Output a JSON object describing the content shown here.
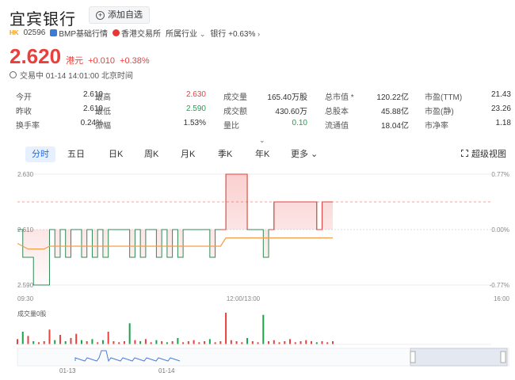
{
  "header": {
    "title": "宜宾银行",
    "fav_label": "添加自选",
    "market_tag": "HK",
    "code": "02596",
    "bmp_label": "BMP基础行情",
    "exchange": "香港交易所",
    "industry_label": "所属行业",
    "industry_value": "银行 +0.63%"
  },
  "quote": {
    "price": "2.620",
    "currency": "港元",
    "change": "+0.010",
    "change_pct": "+0.38%",
    "status": "交易中 01-14 14:01:00 北京时间"
  },
  "stats": [
    [
      {
        "label": "今开",
        "value": "2.610",
        "cls": ""
      },
      {
        "label": "最高",
        "value": "2.630",
        "cls": "up"
      },
      {
        "label": "成交量",
        "value": "165.40万股",
        "cls": ""
      },
      {
        "label": "总市值 *",
        "value": "120.22亿",
        "cls": ""
      },
      {
        "label": "市盈(TTM)",
        "value": "21.43",
        "cls": ""
      }
    ],
    [
      {
        "label": "昨收",
        "value": "2.610",
        "cls": ""
      },
      {
        "label": "最低",
        "value": "2.590",
        "cls": "down"
      },
      {
        "label": "成交额",
        "value": "430.60万",
        "cls": ""
      },
      {
        "label": "总股本",
        "value": "45.88亿",
        "cls": ""
      },
      {
        "label": "市盈(静)",
        "value": "23.26",
        "cls": ""
      }
    ],
    [
      {
        "label": "换手率",
        "value": "0.24%",
        "cls": ""
      },
      {
        "label": "振幅",
        "value": "1.53%",
        "cls": ""
      },
      {
        "label": "量比",
        "value": "0.10",
        "cls": "down"
      },
      {
        "label": "流通值",
        "value": "18.04亿",
        "cls": ""
      },
      {
        "label": "市净率",
        "value": "1.18",
        "cls": ""
      }
    ]
  ],
  "tabs": [
    "分时",
    "五日",
    "日K",
    "周K",
    "月K",
    "季K",
    "年K",
    "更多"
  ],
  "super_view": "超级视图",
  "chart": {
    "ylabels_left": [
      "2.630",
      "2.610",
      "2.590"
    ],
    "ylabels_right": [
      "0.77%",
      "0.00%",
      "-0.77%"
    ],
    "xlabels": [
      "09:30",
      "12:00/13:00",
      "16:00"
    ],
    "volume_title": "成交量0股",
    "nav_labels": [
      "01-13",
      "01-14"
    ],
    "colors": {
      "up": "#e8413d",
      "down": "#1aa34a",
      "line": "#2e8b57",
      "avg": "#f39c4a",
      "nav": "#4a7bd8"
    }
  },
  "chart_data": {
    "type": "line",
    "title": "",
    "xlabel": "",
    "ylabel": "",
    "ylim": [
      2.59,
      2.63
    ],
    "series": [
      {
        "values": [
          2.61,
          2.6,
          2.6,
          2.59,
          2.59,
          2.59,
          2.61,
          2.6,
          2.61,
          2.6,
          2.61,
          2.61,
          2.6,
          2.61,
          2.6,
          2.61,
          2.6,
          2.61,
          2.61,
          2.61,
          2.61,
          2.6,
          2.61,
          2.6,
          2.61,
          2.61,
          2.6,
          2.61,
          2.6,
          2.61,
          2.6,
          2.61,
          2.61,
          2.61,
          2.61,
          2.61,
          2.6,
          2.61,
          2.61,
          2.63,
          2.63,
          2.63,
          2.63,
          2.61,
          2.61,
          2.61,
          2.6,
          2.61,
          2.62,
          2.62,
          2.62,
          2.62,
          2.62,
          2.62,
          2.62,
          2.62,
          2.61,
          2.62,
          2.62,
          2.62
        ]
      },
      {
        "values": [
          2.605,
          2.604,
          2.603,
          2.603,
          2.603,
          2.603,
          2.604,
          2.604,
          2.604,
          2.604,
          2.604,
          2.604,
          2.604,
          2.604,
          2.604,
          2.604,
          2.604,
          2.604,
          2.604,
          2.604,
          2.604,
          2.604,
          2.604,
          2.604,
          2.604,
          2.604,
          2.604,
          2.604,
          2.604,
          2.604,
          2.604,
          2.604,
          2.604,
          2.604,
          2.604,
          2.604,
          2.604,
          2.604,
          2.604,
          2.607,
          2.607,
          2.607,
          2.607,
          2.607,
          2.607,
          2.607,
          2.607,
          2.607,
          2.607,
          2.607,
          2.607,
          2.607,
          2.607,
          2.607,
          2.607,
          2.607,
          2.607,
          2.607,
          2.607,
          2.607
        ]
      }
    ],
    "volume": [
      5,
      12,
      8,
      3,
      2,
      3,
      14,
      4,
      9,
      3,
      6,
      10,
      4,
      3,
      5,
      2,
      4,
      12,
      3,
      2,
      3,
      20,
      4,
      3,
      5,
      2,
      4,
      3,
      2,
      3,
      6,
      2,
      3,
      4,
      2,
      3,
      5,
      2,
      3,
      30,
      4,
      3,
      2,
      6,
      3,
      2,
      28,
      3,
      4,
      2,
      3,
      5,
      2,
      3,
      4,
      3,
      2,
      3,
      2,
      3
    ]
  }
}
